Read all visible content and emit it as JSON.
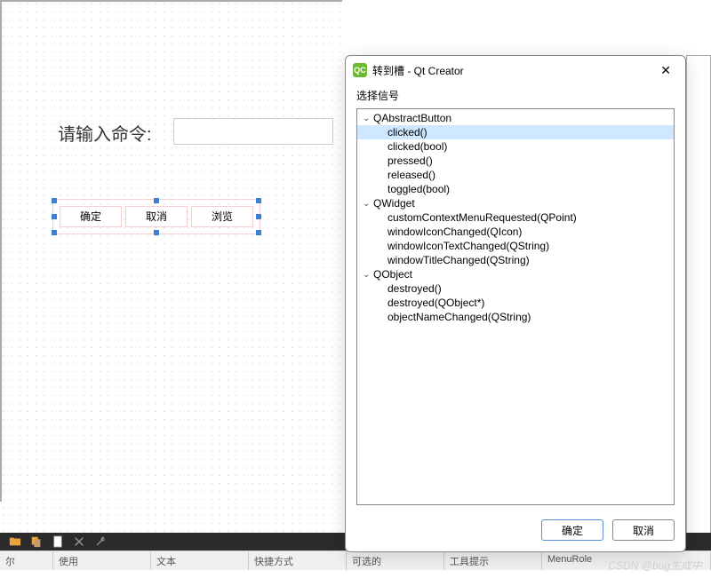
{
  "canvas": {
    "label_prompt": "请输入命令:",
    "buttons": [
      "确定",
      "取消",
      "浏览"
    ]
  },
  "dialog": {
    "title": "转到槽 - Qt Creator",
    "section_label": "选择信号",
    "groups": [
      {
        "name": "QAbstractButton",
        "items": [
          "clicked()",
          "clicked(bool)",
          "pressed()",
          "released()",
          "toggled(bool)"
        ]
      },
      {
        "name": "QWidget",
        "items": [
          "customContextMenuRequested(QPoint)",
          "windowIconChanged(QIcon)",
          "windowIconTextChanged(QString)",
          "windowTitleChanged(QString)"
        ]
      },
      {
        "name": "QObject",
        "items": [
          "destroyed()",
          "destroyed(QObject*)",
          "objectNameChanged(QString)"
        ]
      }
    ],
    "selected": "clicked()",
    "ok": "确定",
    "cancel": "取消"
  },
  "status": {
    "cells": [
      "尔",
      "使用",
      "文本",
      "快捷方式",
      "可选的",
      "工具提示",
      "MenuRole"
    ]
  },
  "watermark": "CSDN @bug生成中"
}
